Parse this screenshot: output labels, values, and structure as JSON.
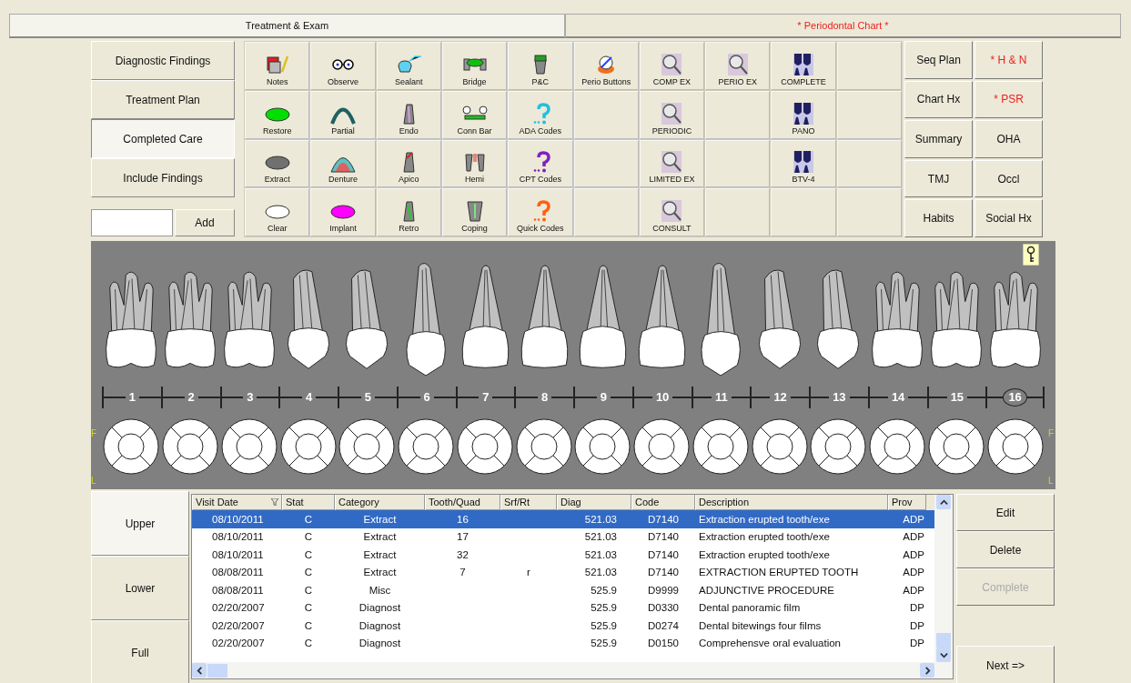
{
  "tabs": [
    {
      "label": "Treatment & Exam",
      "selected": true,
      "alert": false
    },
    {
      "label": "* Periodontal Chart *",
      "selected": false,
      "alert": true
    }
  ],
  "modes": [
    {
      "label": "Diagnostic Findings",
      "selected": false
    },
    {
      "label": "Treatment Plan",
      "selected": false
    },
    {
      "label": "Completed Care",
      "selected": true
    },
    {
      "label": "Include Findings",
      "selected": false
    }
  ],
  "add_button": "Add",
  "tools": [
    [
      {
        "kind": "tool",
        "label": "Notes"
      },
      {
        "kind": "tool",
        "label": "Observe"
      },
      {
        "kind": "tool",
        "label": "Sealant"
      },
      {
        "kind": "tool",
        "label": "Bridge"
      },
      {
        "kind": "tool",
        "label": "P&C"
      },
      {
        "kind": "tool",
        "label": "Perio Buttons"
      },
      {
        "kind": "tool",
        "label": "COMP EX"
      },
      {
        "kind": "tool",
        "label": "PERIO EX"
      },
      {
        "kind": "tool",
        "label": "COMPLETE"
      },
      {
        "kind": "blank"
      }
    ],
    [
      {
        "kind": "tool",
        "label": "Restore"
      },
      {
        "kind": "tool",
        "label": "Partial"
      },
      {
        "kind": "tool",
        "label": "Endo"
      },
      {
        "kind": "tool",
        "label": "Conn Bar"
      },
      {
        "kind": "tool",
        "label": "ADA Codes"
      },
      {
        "kind": "blank"
      },
      {
        "kind": "tool",
        "label": "PERIODIC"
      },
      {
        "kind": "blank"
      },
      {
        "kind": "tool",
        "label": "PANO"
      },
      {
        "kind": "blank"
      }
    ],
    [
      {
        "kind": "tool",
        "label": "Extract"
      },
      {
        "kind": "tool",
        "label": "Denture"
      },
      {
        "kind": "tool",
        "label": "Apico"
      },
      {
        "kind": "tool",
        "label": "Hemi"
      },
      {
        "kind": "tool",
        "label": "CPT Codes"
      },
      {
        "kind": "blank"
      },
      {
        "kind": "tool",
        "label": "LIMITED EX"
      },
      {
        "kind": "blank"
      },
      {
        "kind": "tool",
        "label": "BTV-4"
      },
      {
        "kind": "blank"
      }
    ],
    [
      {
        "kind": "tool",
        "label": "Clear"
      },
      {
        "kind": "tool",
        "label": "Implant"
      },
      {
        "kind": "tool",
        "label": "Retro"
      },
      {
        "kind": "tool",
        "label": "Coping"
      },
      {
        "kind": "tool",
        "label": "Quick Codes"
      },
      {
        "kind": "blank"
      },
      {
        "kind": "tool",
        "label": "CONSULT"
      },
      {
        "kind": "blank"
      },
      {
        "kind": "blank"
      },
      {
        "kind": "blank"
      }
    ]
  ],
  "side_buttons": [
    {
      "label": "Seq Plan",
      "alert": false
    },
    {
      "label": "* H & N",
      "alert": true
    },
    {
      "label": "Chart Hx",
      "alert": false
    },
    {
      "label": "* PSR",
      "alert": true
    },
    {
      "label": "Summary",
      "alert": false
    },
    {
      "label": "OHA",
      "alert": false
    },
    {
      "label": "TMJ",
      "alert": false
    },
    {
      "label": "Occl",
      "alert": false
    },
    {
      "label": "Habits",
      "alert": false
    },
    {
      "label": "Social Hx",
      "alert": false
    }
  ],
  "chart": {
    "left_labels": [
      "F",
      "L"
    ],
    "right_labels": [
      "F",
      "L"
    ],
    "teeth": [
      {
        "number": "1",
        "kind": "molar",
        "selected": false
      },
      {
        "number": "2",
        "kind": "molar",
        "selected": false
      },
      {
        "number": "3",
        "kind": "molar",
        "selected": false
      },
      {
        "number": "4",
        "kind": "premolar",
        "selected": false
      },
      {
        "number": "5",
        "kind": "premolar",
        "selected": false
      },
      {
        "number": "6",
        "kind": "canine",
        "selected": false
      },
      {
        "number": "7",
        "kind": "incisor",
        "selected": false
      },
      {
        "number": "8",
        "kind": "incisor",
        "selected": false
      },
      {
        "number": "9",
        "kind": "incisor",
        "selected": false
      },
      {
        "number": "10",
        "kind": "incisor",
        "selected": false
      },
      {
        "number": "11",
        "kind": "canine",
        "selected": false
      },
      {
        "number": "12",
        "kind": "premolar",
        "selected": false
      },
      {
        "number": "13",
        "kind": "premolar",
        "selected": false
      },
      {
        "number": "14",
        "kind": "molar",
        "selected": false
      },
      {
        "number": "15",
        "kind": "molar",
        "selected": false
      },
      {
        "number": "16",
        "kind": "molar",
        "selected": true
      }
    ]
  },
  "arches": [
    {
      "label": "Upper",
      "selected": true
    },
    {
      "label": "Lower",
      "selected": false
    },
    {
      "label": "Full",
      "selected": false
    }
  ],
  "table": {
    "columns": [
      "Visit Date",
      "Stat",
      "Category",
      "Tooth/Quad",
      "Srf/Rt",
      "Diag",
      "Code",
      "Description",
      "Prov"
    ],
    "rows": [
      {
        "selected": true,
        "visit_date": "08/10/2011",
        "stat": "C",
        "category": "Extract",
        "tooth_quad": "16",
        "diag": "521.03",
        "code": "D7140",
        "description": "Extraction erupted tooth/exe",
        "prov": "ADP"
      },
      {
        "selected": false,
        "visit_date": "08/10/2011",
        "stat": "C",
        "category": "Extract",
        "tooth_quad": "17",
        "diag": "521.03",
        "code": "D7140",
        "description": "Extraction erupted tooth/exe",
        "prov": "ADP"
      },
      {
        "selected": false,
        "visit_date": "08/10/2011",
        "stat": "C",
        "category": "Extract",
        "tooth_quad": "32",
        "diag": "521.03",
        "code": "D7140",
        "description": "Extraction erupted tooth/exe",
        "prov": "ADP"
      },
      {
        "selected": false,
        "visit_date": "08/08/2011",
        "stat": "C",
        "category": "Extract",
        "tooth_quad": "7",
        "srf_rt": "r",
        "diag": "521.03",
        "code": "D7140",
        "description": "EXTRACTION ERUPTED TOOTH",
        "prov": "ADP"
      },
      {
        "selected": false,
        "visit_date": "08/08/2011",
        "stat": "C",
        "category": "Misc",
        "diag": "525.9",
        "code": "D9999",
        "description": "ADJUNCTIVE PROCEDURE",
        "prov": "ADP"
      },
      {
        "selected": false,
        "visit_date": "02/20/2007",
        "stat": "C",
        "category": "Diagnost",
        "diag": "525.9",
        "code": "D0330",
        "description": "Dental panoramic film",
        "prov": "DP"
      },
      {
        "selected": false,
        "visit_date": "02/20/2007",
        "stat": "C",
        "category": "Diagnost",
        "diag": "525.9",
        "code": "D0274",
        "description": "Dental bitewings four films",
        "prov": "DP"
      },
      {
        "selected": false,
        "visit_date": "02/20/2007",
        "stat": "C",
        "category": "Diagnost",
        "diag": "525.9",
        "code": "D0150",
        "description": "Comprehensve oral evaluation",
        "prov": "DP"
      }
    ]
  },
  "actions": [
    {
      "label": "Edit",
      "disabled": false
    },
    {
      "label": "Delete",
      "disabled": false
    },
    {
      "label": "Complete",
      "disabled": true
    }
  ],
  "next_button": "Next =>"
}
